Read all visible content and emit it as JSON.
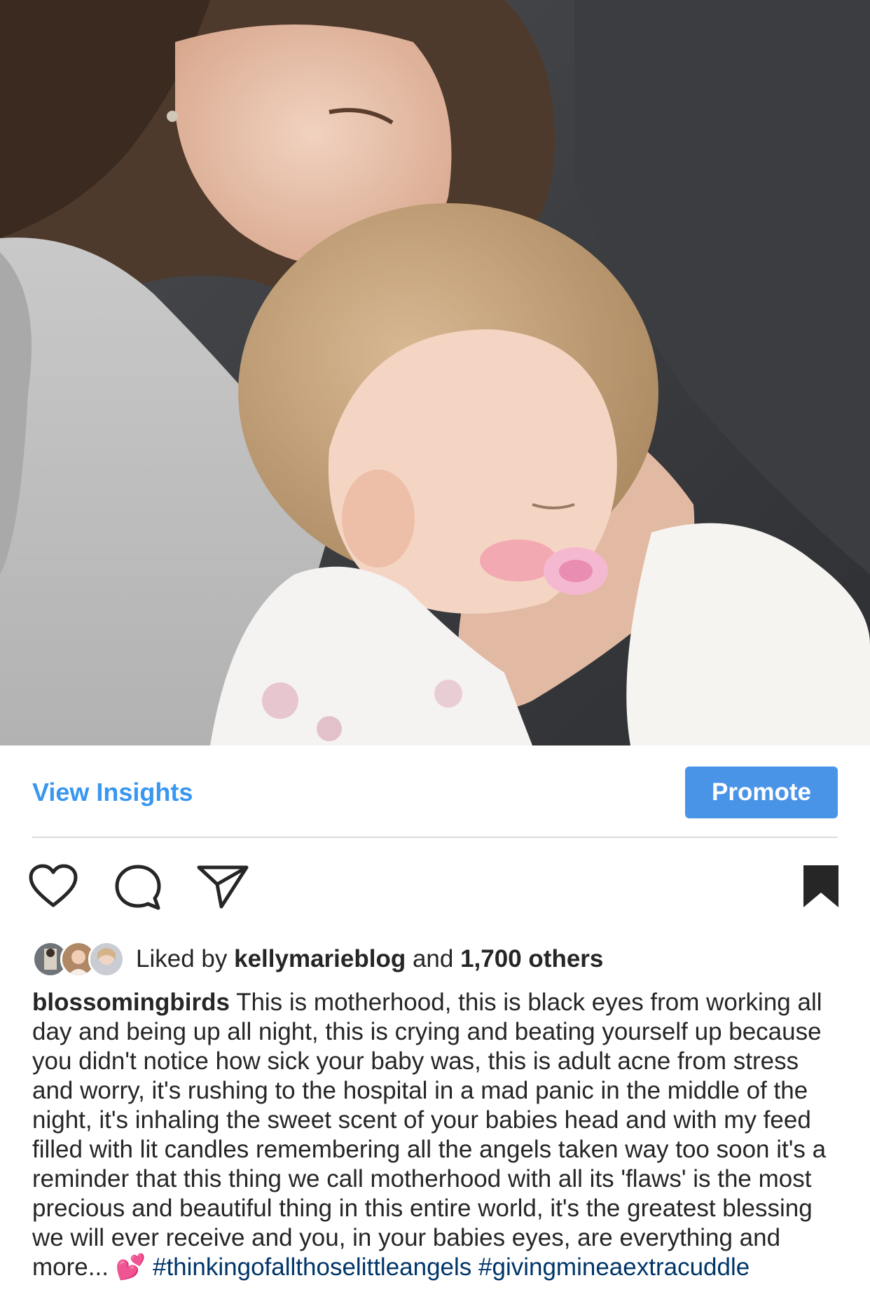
{
  "post": {
    "photo_alt": "",
    "insights": {
      "view_insights_label": "View Insights",
      "promote_label": "Promote"
    },
    "actions": {
      "icons": [
        "heart-icon",
        "comment-icon",
        "share-icon",
        "bookmark-icon"
      ]
    },
    "likes": {
      "prefix": "Liked by",
      "user": "kellymarieblog",
      "conjunction": "and",
      "others": "1,700 others"
    },
    "caption": {
      "username": "blossomingbirds",
      "text": "This is motherhood, this is black eyes from working all day and being up all night, this is crying and beating yourself up because you didn't notice how sick your baby was, this is adult acne from stress and worry, it's rushing to the hospital in a mad panic in the middle of the night, it's inhaling the sweet scent of your babies head and with my feed filled with lit candles remembering all the angels taken way too soon it's a reminder that this thing we call motherhood with all its 'flaws' is the most precious and beautiful thing in this entire world, it's the greatest blessing we will ever receive and you, in your babies eyes, are everything and",
      "more": "more...",
      "emoji": "💕",
      "hashtags": "#thinkingofallthoselittleangels #givingmineaextracuddle"
    }
  },
  "colors": {
    "link_blue": "#3897f0",
    "promote_bg": "#4a94e8",
    "hashtag": "#003569",
    "text": "#262626",
    "divider": "#dbdbdb"
  }
}
